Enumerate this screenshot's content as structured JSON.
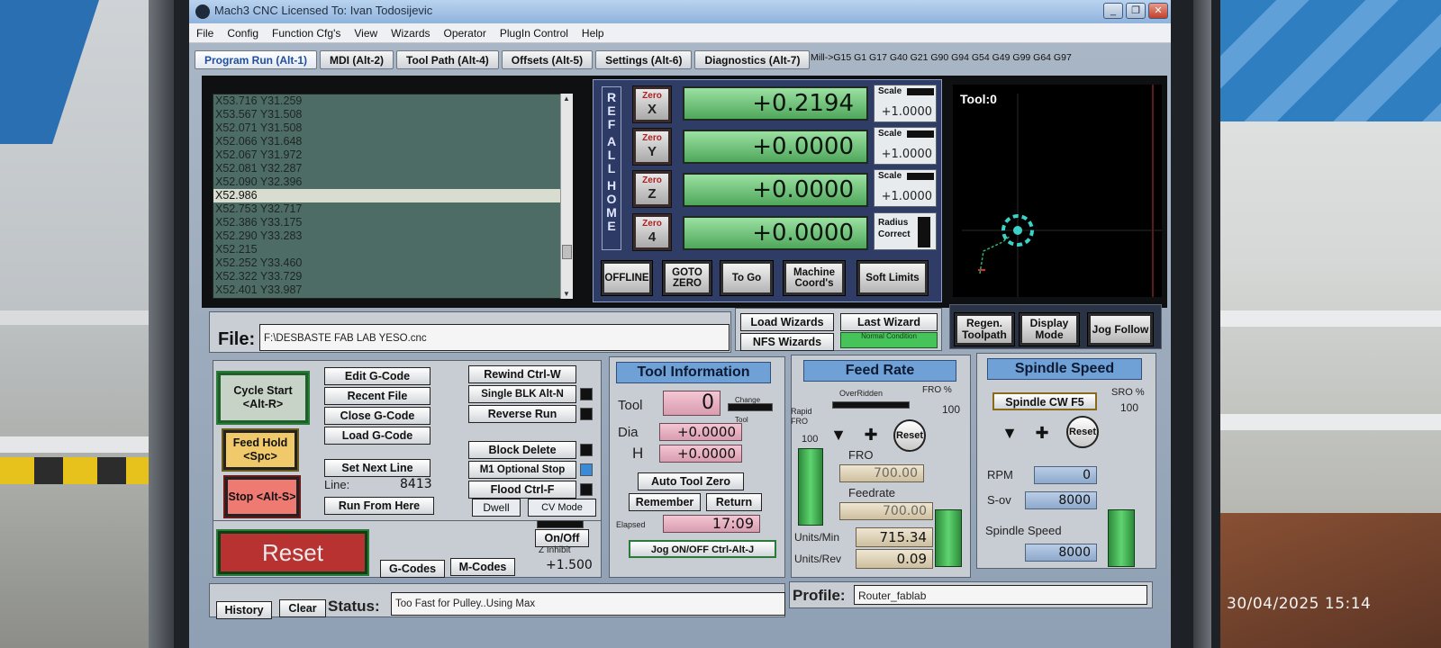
{
  "photo": {
    "timestamp": "30/04/2025  15:14"
  },
  "window": {
    "title": "Mach3 CNC  Licensed To: Ivan Todosijevic",
    "btn_min": "_",
    "btn_max": "❐",
    "btn_close": "✕"
  },
  "menu": [
    "File",
    "Config",
    "Function Cfg's",
    "View",
    "Wizards",
    "Operator",
    "PlugIn Control",
    "Help"
  ],
  "tabs": [
    "Program Run (Alt-1)",
    "MDI (Alt-2)",
    "Tool Path (Alt-4)",
    "Offsets (Alt-5)",
    "Settings (Alt-6)",
    "Diagnostics (Alt-7)"
  ],
  "gcode_state": "Mill->G15  G1 G17 G40 G21 G90 G94 G54 G49 G99 G64 G97",
  "gcode_lines": [
    "X53.716 Y31.259",
    "X53.567 Y31.508",
    "X52.071 Y31.508",
    "X52.066 Y31.648",
    "X52.067 Y31.972",
    "X52.081 Y32.287",
    "X52.090 Y32.396",
    "X52.986",
    "X52.753 Y32.717",
    "X52.386 Y33.175",
    "X52.290 Y33.283",
    "X52.215",
    "X52.252 Y33.460",
    "X52.322 Y33.729",
    "X52.401 Y33.987"
  ],
  "gcode_selected_index": 7,
  "dro": {
    "ref_all_home": [
      "R",
      "E",
      "F",
      "A",
      "L",
      "L",
      "H",
      "O",
      "M",
      "E"
    ],
    "axes": [
      {
        "zero_top": "Zero",
        "zero_axis": "X",
        "value": "+0.2194",
        "scale_label": "Scale",
        "scale": "+1.0000"
      },
      {
        "zero_top": "Zero",
        "zero_axis": "Y",
        "value": "+0.0000",
        "scale_label": "Scale",
        "scale": "+1.0000"
      },
      {
        "zero_top": "Zero",
        "zero_axis": "Z",
        "value": "+0.0000",
        "scale_label": "Scale",
        "scale": "+1.0000"
      },
      {
        "zero_top": "Zero",
        "zero_axis": "4",
        "value": "+0.0000"
      }
    ],
    "radius_correct": "Radius Correct",
    "buttons": {
      "offline": "OFFLINE",
      "goto_zero": "GOTO ZERO",
      "to_go": "To Go",
      "machine_coords": "Machine Coord's",
      "soft_limits": "Soft Limits"
    }
  },
  "toolpath": {
    "tool_label": "Tool:0"
  },
  "file": {
    "label": "File:",
    "path": "F:\\DESBASTE FAB LAB YESO.cnc"
  },
  "wizards": {
    "load": "Load Wizards",
    "last": "Last Wizard",
    "nfs": "NFS Wizards",
    "normal": "Normal Condition"
  },
  "view_buttons": {
    "regen": "Regen. Toolpath",
    "display": "Display Mode",
    "jog": "Jog Follow"
  },
  "program": {
    "cycle_start": "Cycle Start <Alt-R>",
    "feed_hold": "Feed Hold <Spc>",
    "stop": "Stop <Alt-S>",
    "edit": "Edit G-Code",
    "recent": "Recent File",
    "close": "Close G-Code",
    "load": "Load G-Code",
    "set_next": "Set Next Line",
    "line_label": "Line:",
    "line_value": "8413",
    "run_from": "Run From Here",
    "rewind": "Rewind Ctrl-W",
    "single_blk": "Single BLK Alt-N",
    "reverse": "Reverse Run",
    "block_delete": "Block Delete",
    "m1": "M1 Optional Stop",
    "flood": "Flood Ctrl-F",
    "dwell": "Dwell",
    "cv_mode": "CV Mode"
  },
  "reset": {
    "label": "Reset",
    "gcodes": "G-Codes",
    "mcodes": "M-Codes",
    "onoff": "On/Off",
    "z_inhibit": "Z Inhibit",
    "z_value": "+1.500"
  },
  "tool_info": {
    "title": "Tool Information",
    "tool_label": "Tool",
    "tool_value": "0",
    "change_label": "Change Tool",
    "dia_label": "Dia",
    "dia_value": "+0.0000",
    "h_label": "H",
    "h_value": "+0.0000",
    "auto_zero": "Auto Tool Zero",
    "remember": "Remember",
    "return": "Return",
    "elapsed_label": "Elapsed",
    "elapsed_value": "17:09",
    "jog": "Jog ON/OFF Ctrl-Alt-J"
  },
  "feed": {
    "title": "Feed Rate",
    "overridden": "OverRidden",
    "fro_pct_label": "FRO %",
    "fro_pct": "100",
    "rapid_fro_label": "Rapid FRO",
    "rapid_fro": "100",
    "reset": "Reset",
    "fro_label": "FRO",
    "fro_value": "700.00",
    "feedrate_label": "Feedrate",
    "feedrate_value": "700.00",
    "units_min_label": "Units/Min",
    "units_min": "715.34",
    "units_rev_label": "Units/Rev",
    "units_rev": "0.09"
  },
  "spindle": {
    "title": "Spindle Speed",
    "cw": "Spindle CW F5",
    "sro_label": "SRO %",
    "sro": "100",
    "reset": "Reset",
    "rpm_label": "RPM",
    "rpm": "0",
    "sov_label": "S-ov",
    "sov": "8000",
    "speed_label": "Spindle Speed",
    "speed": "8000"
  },
  "status": {
    "history": "History",
    "clear": "Clear",
    "label": "Status:",
    "text": "Too Fast for Pulley..Using Max",
    "profile_label": "Profile:",
    "profile": "Router_fablab"
  }
}
